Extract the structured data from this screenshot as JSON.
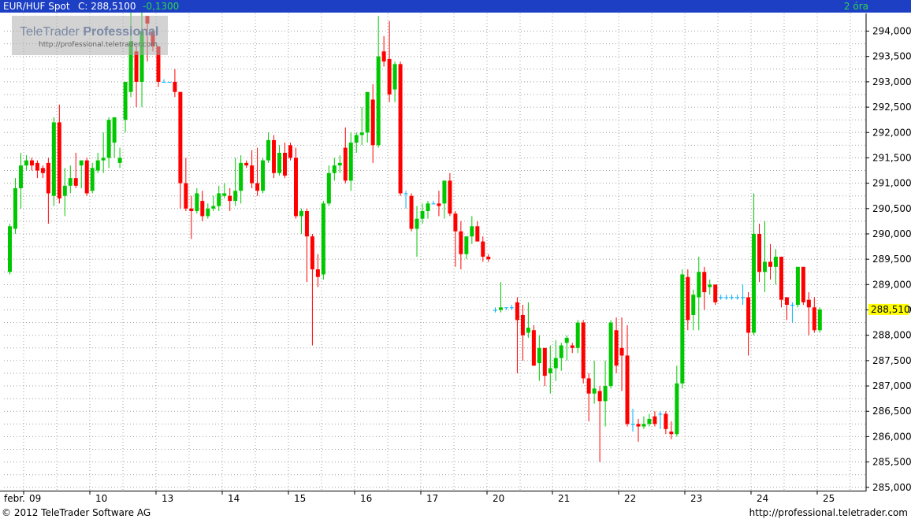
{
  "header": {
    "symbol": "EUR/HUF Spot",
    "close": "C: 288,5100",
    "change": "-0,1300",
    "period": "2 óra"
  },
  "watermark": {
    "brand_light": "TeleTrader",
    "brand_bold": "Professional",
    "url": "http://professional.teletrader.com"
  },
  "footer": {
    "copyright": "© 2012 TeleTrader Software AG",
    "url": "http://professional.teletrader.com"
  },
  "colors": {
    "up": "#00c800",
    "down": "#ff0000",
    "flat": "#00b0ff",
    "title_bar": "#1c3fc4",
    "price_tag": "#ffff00",
    "grid": "#a0a0a0"
  },
  "chart_data": {
    "type": "candlestick",
    "title": "EUR/HUF Spot",
    "interval": "2 óra",
    "ylim": [
      284.95,
      294.35
    ],
    "y_ticks": [
      "294,0000",
      "293,5000",
      "293,0000",
      "292,5000",
      "292,0000",
      "291,5000",
      "291,0000",
      "290,5000",
      "290,0000",
      "289,5000",
      "289,0000",
      "288,5000",
      "288,0000",
      "287,5000",
      "287,0000",
      "286,5000",
      "286,0000",
      "285,5000",
      "285,0000"
    ],
    "y_tick_values": [
      294,
      293.5,
      293,
      292.5,
      292,
      291.5,
      291,
      290.5,
      290,
      289.5,
      289,
      288.5,
      288,
      287.5,
      287,
      286.5,
      286,
      285.5,
      285
    ],
    "last_price": "288,5100",
    "last_value": 288.51,
    "x_labels": [
      "febr.",
      "09",
      "10",
      "13",
      "14",
      "15",
      "16",
      "17",
      "20",
      "21",
      "22",
      "23",
      "24",
      "25"
    ],
    "candles": [
      {
        "o": 289.25,
        "h": 290.2,
        "l": 289.2,
        "c": 290.15
      },
      {
        "o": 290.1,
        "h": 291.1,
        "l": 290.0,
        "c": 290.9
      },
      {
        "o": 290.9,
        "h": 291.6,
        "l": 290.5,
        "c": 291.35
      },
      {
        "o": 291.35,
        "h": 291.55,
        "l": 291.25,
        "c": 291.45
      },
      {
        "o": 291.45,
        "h": 291.5,
        "l": 291.25,
        "c": 291.35
      },
      {
        "o": 291.4,
        "h": 291.45,
        "l": 291.1,
        "c": 291.25
      },
      {
        "o": 291.3,
        "h": 291.35,
        "l": 291.1,
        "c": 291.2
      },
      {
        "o": 291.4,
        "h": 291.5,
        "l": 290.2,
        "c": 290.8
      },
      {
        "o": 290.75,
        "h": 292.3,
        "l": 290.55,
        "c": 292.2
      },
      {
        "o": 292.2,
        "h": 292.55,
        "l": 290.6,
        "c": 290.7
      },
      {
        "o": 290.75,
        "h": 291.3,
        "l": 290.35,
        "c": 290.95
      },
      {
        "o": 290.95,
        "h": 291.35,
        "l": 290.8,
        "c": 291.1
      },
      {
        "o": 291.1,
        "h": 291.6,
        "l": 290.9,
        "c": 290.95
      },
      {
        "o": 291.35,
        "h": 291.45,
        "l": 290.9,
        "c": 291.45
      },
      {
        "o": 291.45,
        "h": 291.5,
        "l": 290.75,
        "c": 290.8
      },
      {
        "o": 290.85,
        "h": 291.4,
        "l": 290.8,
        "c": 291.3
      },
      {
        "o": 291.25,
        "h": 291.6,
        "l": 291.2,
        "c": 291.45
      },
      {
        "o": 291.45,
        "h": 292.0,
        "l": 291.2,
        "c": 291.5
      },
      {
        "o": 291.5,
        "h": 292.3,
        "l": 291.3,
        "c": 292.25
      },
      {
        "o": 291.8,
        "h": 292.3,
        "l": 291.5,
        "c": 292.3
      },
      {
        "o": 291.4,
        "h": 291.7,
        "l": 291.3,
        "c": 291.5
      },
      {
        "o": 292.25,
        "h": 293.0,
        "l": 292.0,
        "c": 293.0
      },
      {
        "o": 292.8,
        "h": 294.5,
        "l": 292.7,
        "c": 293.8
      },
      {
        "o": 293.6,
        "h": 293.7,
        "l": 292.5,
        "c": 293.0
      },
      {
        "o": 293.0,
        "h": 294.5,
        "l": 292.5,
        "c": 294.0
      },
      {
        "o": 294.3,
        "h": 294.3,
        "l": 293.4,
        "c": 294.15
      },
      {
        "o": 294.0,
        "h": 294.05,
        "l": 293.6,
        "c": 293.7
      },
      {
        "o": 293.7,
        "h": 293.7,
        "l": 292.9,
        "c": 293.0
      },
      {
        "o": 293.0,
        "h": 293.05,
        "l": 293.0,
        "c": 293.0
      },
      {
        "o": 293.0,
        "h": 293.0,
        "l": 293.0,
        "c": 293.0
      },
      {
        "o": 293.0,
        "h": 293.25,
        "l": 292.7,
        "c": 292.8
      },
      {
        "o": 292.8,
        "h": 292.8,
        "l": 290.5,
        "c": 291.0
      },
      {
        "o": 291.0,
        "h": 291.5,
        "l": 290.45,
        "c": 290.5
      },
      {
        "o": 290.5,
        "h": 290.75,
        "l": 289.9,
        "c": 290.45
      },
      {
        "o": 290.45,
        "h": 290.9,
        "l": 290.4,
        "c": 290.8
      },
      {
        "o": 290.65,
        "h": 290.85,
        "l": 290.25,
        "c": 290.35
      },
      {
        "o": 290.35,
        "h": 290.6,
        "l": 290.3,
        "c": 290.5
      },
      {
        "o": 290.5,
        "h": 290.75,
        "l": 290.45,
        "c": 290.55
      },
      {
        "o": 290.55,
        "h": 290.95,
        "l": 290.45,
        "c": 290.8
      },
      {
        "o": 290.75,
        "h": 291.0,
        "l": 290.7,
        "c": 290.8
      },
      {
        "o": 290.75,
        "h": 290.9,
        "l": 290.45,
        "c": 290.65
      },
      {
        "o": 290.65,
        "h": 291.5,
        "l": 290.55,
        "c": 290.85
      },
      {
        "o": 290.85,
        "h": 291.55,
        "l": 290.6,
        "c": 291.4
      },
      {
        "o": 291.4,
        "h": 291.45,
        "l": 291.3,
        "c": 291.35
      },
      {
        "o": 291.35,
        "h": 291.65,
        "l": 290.9,
        "c": 291.0
      },
      {
        "o": 291.0,
        "h": 291.7,
        "l": 290.75,
        "c": 290.85
      },
      {
        "o": 290.85,
        "h": 291.5,
        "l": 290.8,
        "c": 291.45
      },
      {
        "o": 291.45,
        "h": 292.0,
        "l": 291.4,
        "c": 291.85
      },
      {
        "o": 291.85,
        "h": 291.95,
        "l": 291.1,
        "c": 291.2
      },
      {
        "o": 291.2,
        "h": 291.75,
        "l": 291.15,
        "c": 291.6
      },
      {
        "o": 291.6,
        "h": 291.8,
        "l": 291.1,
        "c": 291.15
      },
      {
        "o": 291.75,
        "h": 291.8,
        "l": 291.45,
        "c": 291.5
      },
      {
        "o": 291.5,
        "h": 291.7,
        "l": 290.3,
        "c": 290.35
      },
      {
        "o": 290.35,
        "h": 290.5,
        "l": 290.0,
        "c": 290.45
      },
      {
        "o": 290.45,
        "h": 290.5,
        "l": 289.05,
        "c": 289.95
      },
      {
        "o": 289.95,
        "h": 290.0,
        "l": 287.8,
        "c": 289.3
      },
      {
        "o": 289.3,
        "h": 289.6,
        "l": 288.95,
        "c": 289.15
      },
      {
        "o": 289.2,
        "h": 290.65,
        "l": 289.1,
        "c": 290.6
      },
      {
        "o": 290.6,
        "h": 291.35,
        "l": 290.55,
        "c": 291.2
      },
      {
        "o": 291.2,
        "h": 291.5,
        "l": 291.05,
        "c": 291.35
      },
      {
        "o": 291.35,
        "h": 291.55,
        "l": 291.2,
        "c": 291.4
      },
      {
        "o": 291.7,
        "h": 292.1,
        "l": 291.0,
        "c": 291.05
      },
      {
        "o": 291.05,
        "h": 292.0,
        "l": 290.85,
        "c": 291.8
      },
      {
        "o": 291.8,
        "h": 292.0,
        "l": 291.6,
        "c": 291.95
      },
      {
        "o": 291.95,
        "h": 292.5,
        "l": 291.75,
        "c": 292.0
      },
      {
        "o": 292.0,
        "h": 292.8,
        "l": 291.8,
        "c": 292.8
      },
      {
        "o": 292.65,
        "h": 292.95,
        "l": 291.4,
        "c": 291.75
      },
      {
        "o": 291.75,
        "h": 294.3,
        "l": 291.7,
        "c": 293.5
      },
      {
        "o": 293.6,
        "h": 293.9,
        "l": 293.3,
        "c": 293.4
      },
      {
        "o": 293.45,
        "h": 294.2,
        "l": 292.6,
        "c": 292.75
      },
      {
        "o": 292.85,
        "h": 293.4,
        "l": 292.6,
        "c": 293.35
      },
      {
        "o": 293.35,
        "h": 293.4,
        "l": 290.75,
        "c": 290.8
      },
      {
        "o": 290.8,
        "h": 290.85,
        "l": 290.5,
        "c": 290.8
      },
      {
        "o": 290.75,
        "h": 290.8,
        "l": 290.05,
        "c": 290.1
      },
      {
        "o": 290.1,
        "h": 290.55,
        "l": 289.55,
        "c": 290.3
      },
      {
        "o": 290.3,
        "h": 290.6,
        "l": 290.2,
        "c": 290.45
      },
      {
        "o": 290.45,
        "h": 290.65,
        "l": 290.3,
        "c": 290.6
      },
      {
        "o": 290.6,
        "h": 290.65,
        "l": 290.6,
        "c": 290.6
      },
      {
        "o": 290.6,
        "h": 290.85,
        "l": 290.35,
        "c": 290.55
      },
      {
        "o": 290.6,
        "h": 291.05,
        "l": 290.3,
        "c": 291.05
      },
      {
        "o": 291.05,
        "h": 291.2,
        "l": 290.35,
        "c": 290.4
      },
      {
        "o": 290.4,
        "h": 290.45,
        "l": 289.35,
        "c": 290.05
      },
      {
        "o": 290.05,
        "h": 290.25,
        "l": 289.3,
        "c": 289.6
      },
      {
        "o": 289.6,
        "h": 289.95,
        "l": 289.5,
        "c": 289.95
      },
      {
        "o": 289.95,
        "h": 290.35,
        "l": 289.8,
        "c": 290.15
      },
      {
        "o": 290.15,
        "h": 290.25,
        "l": 289.85,
        "c": 289.85
      },
      {
        "o": 289.85,
        "h": 289.95,
        "l": 289.45,
        "c": 289.55
      },
      {
        "o": 289.55,
        "h": 289.6,
        "l": 289.45,
        "c": 289.5
      }
    ],
    "candles_2": [
      {
        "o": 288.5,
        "h": 288.55,
        "l": 288.45,
        "c": 288.5
      },
      {
        "o": 288.5,
        "h": 289.05,
        "l": 288.45,
        "c": 288.55
      },
      {
        "o": 288.55,
        "h": 288.55,
        "l": 288.5,
        "c": 288.55
      },
      {
        "o": 288.55,
        "h": 288.6,
        "l": 288.5,
        "c": 288.55
      },
      {
        "o": 288.65,
        "h": 288.75,
        "l": 287.25,
        "c": 288.3
      },
      {
        "o": 288.4,
        "h": 288.6,
        "l": 287.5,
        "c": 288.0
      },
      {
        "o": 288.05,
        "h": 288.65,
        "l": 287.95,
        "c": 288.15
      },
      {
        "o": 288.1,
        "h": 288.2,
        "l": 287.4,
        "c": 287.4
      },
      {
        "o": 287.45,
        "h": 288.0,
        "l": 287.1,
        "c": 287.75
      },
      {
        "o": 287.75,
        "h": 287.7,
        "l": 287.0,
        "c": 287.2
      },
      {
        "o": 287.25,
        "h": 287.8,
        "l": 286.85,
        "c": 287.35
      },
      {
        "o": 287.35,
        "h": 287.9,
        "l": 287.1,
        "c": 287.55
      },
      {
        "o": 287.55,
        "h": 287.85,
        "l": 287.3,
        "c": 287.8
      },
      {
        "o": 287.85,
        "h": 288.0,
        "l": 287.5,
        "c": 287.95
      },
      {
        "o": 287.8,
        "h": 287.85,
        "l": 287.65,
        "c": 287.75
      },
      {
        "o": 287.75,
        "h": 288.3,
        "l": 287.65,
        "c": 288.25
      },
      {
        "o": 288.25,
        "h": 288.3,
        "l": 287.05,
        "c": 287.15
      },
      {
        "o": 287.15,
        "h": 287.25,
        "l": 286.3,
        "c": 286.85
      },
      {
        "o": 286.85,
        "h": 287.5,
        "l": 286.65,
        "c": 286.95
      },
      {
        "o": 286.9,
        "h": 287.0,
        "l": 285.5,
        "c": 286.7
      },
      {
        "o": 286.7,
        "h": 287.5,
        "l": 286.2,
        "c": 287.0
      },
      {
        "o": 287.0,
        "h": 288.3,
        "l": 286.95,
        "c": 288.25
      },
      {
        "o": 288.1,
        "h": 288.35,
        "l": 287.25,
        "c": 287.4
      },
      {
        "o": 287.75,
        "h": 288.35,
        "l": 286.9,
        "c": 287.6
      },
      {
        "o": 287.6,
        "h": 288.2,
        "l": 286.2,
        "c": 286.25
      },
      {
        "o": 286.25,
        "h": 286.55,
        "l": 286.1,
        "c": 286.25
      },
      {
        "o": 286.25,
        "h": 286.35,
        "l": 285.9,
        "c": 286.2
      },
      {
        "o": 286.2,
        "h": 286.4,
        "l": 286.15,
        "c": 286.25
      },
      {
        "o": 286.25,
        "h": 286.45,
        "l": 286.2,
        "c": 286.35
      },
      {
        "o": 286.4,
        "h": 286.5,
        "l": 286.2,
        "c": 286.25
      },
      {
        "o": 286.45,
        "h": 286.5,
        "l": 286.15,
        "c": 286.45
      },
      {
        "o": 286.45,
        "h": 286.5,
        "l": 286.05,
        "c": 286.15
      },
      {
        "o": 286.1,
        "h": 286.3,
        "l": 285.95,
        "c": 286.05
      },
      {
        "o": 286.05,
        "h": 287.4,
        "l": 286.0,
        "c": 287.05
      },
      {
        "o": 287.05,
        "h": 289.3,
        "l": 286.95,
        "c": 289.2
      },
      {
        "o": 289.15,
        "h": 289.3,
        "l": 288.1,
        "c": 288.3
      },
      {
        "o": 288.4,
        "h": 288.9,
        "l": 288.1,
        "c": 288.8
      },
      {
        "o": 288.75,
        "h": 289.55,
        "l": 288.1,
        "c": 289.25
      },
      {
        "o": 289.25,
        "h": 289.35,
        "l": 288.5,
        "c": 288.85
      },
      {
        "o": 288.95,
        "h": 289.1,
        "l": 288.8,
        "c": 289.0
      },
      {
        "o": 289.0,
        "h": 289.0,
        "l": 288.6,
        "c": 288.65
      },
      {
        "o": 288.75,
        "h": 288.8,
        "l": 288.7,
        "c": 288.75
      },
      {
        "o": 288.75,
        "h": 288.8,
        "l": 288.7,
        "c": 288.75
      },
      {
        "o": 288.75,
        "h": 288.8,
        "l": 288.7,
        "c": 288.75
      },
      {
        "o": 288.75,
        "h": 288.8,
        "l": 288.7,
        "c": 288.75
      },
      {
        "o": 288.75,
        "h": 289.0,
        "l": 288.6,
        "c": 288.75
      },
      {
        "o": 288.75,
        "h": 288.85,
        "l": 287.6,
        "c": 288.05
      },
      {
        "o": 288.05,
        "h": 290.8,
        "l": 288.0,
        "c": 290.0
      },
      {
        "o": 290.0,
        "h": 290.2,
        "l": 289.05,
        "c": 289.25
      },
      {
        "o": 289.25,
        "h": 290.25,
        "l": 288.85,
        "c": 289.45
      },
      {
        "o": 289.45,
        "h": 289.8,
        "l": 289.1,
        "c": 289.35
      },
      {
        "o": 289.35,
        "h": 289.7,
        "l": 289.0,
        "c": 289.55
      },
      {
        "o": 289.55,
        "h": 289.55,
        "l": 288.55,
        "c": 288.7
      },
      {
        "o": 288.75,
        "h": 288.75,
        "l": 288.3,
        "c": 288.6
      },
      {
        "o": 288.6,
        "h": 288.65,
        "l": 288.25,
        "c": 288.6
      },
      {
        "o": 288.6,
        "h": 289.35,
        "l": 288.55,
        "c": 289.35
      },
      {
        "o": 289.35,
        "h": 289.35,
        "l": 288.6,
        "c": 288.65
      },
      {
        "o": 288.7,
        "h": 288.85,
        "l": 288.0,
        "c": 288.55
      },
      {
        "o": 288.55,
        "h": 288.75,
        "l": 288.05,
        "c": 288.1
      },
      {
        "o": 288.1,
        "h": 288.55,
        "l": 288.05,
        "c": 288.51
      }
    ]
  }
}
